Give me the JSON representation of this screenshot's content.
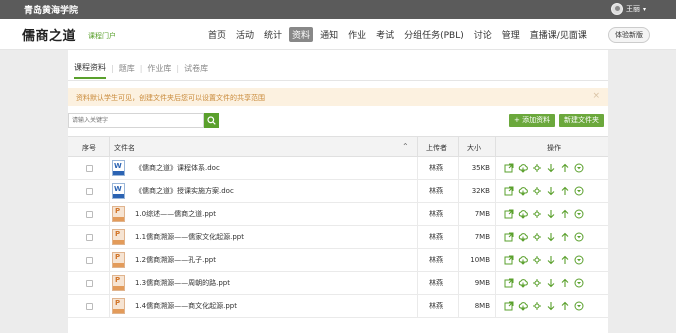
{
  "topbar": {
    "school": "青岛黄海学院",
    "user": "王丽"
  },
  "navbar": {
    "brand": "儒商之道",
    "brand_sub": "课程门户",
    "items": [
      {
        "label": "首页",
        "active": false
      },
      {
        "label": "活动",
        "active": false
      },
      {
        "label": "统计",
        "active": false
      },
      {
        "label": "资料",
        "active": true
      },
      {
        "label": "通知",
        "active": false
      },
      {
        "label": "作业",
        "active": false
      },
      {
        "label": "考试",
        "active": false
      },
      {
        "label": "分组任务(PBL)",
        "active": false
      },
      {
        "label": "讨论",
        "active": false
      },
      {
        "label": "管理",
        "active": false
      },
      {
        "label": "直播课/见面课",
        "active": false
      }
    ],
    "new_version": "体验新版"
  },
  "tabs": [
    "课程资料",
    "题库",
    "作业库",
    "试卷库"
  ],
  "notice": {
    "text": "资料默认学生可见，创建文件夹后您可以设置文件的共享范围",
    "close": "×"
  },
  "search": {
    "placeholder": "请输入关键字"
  },
  "buttons": {
    "add": "+ 添加资料",
    "new_folder": "新建文件夹"
  },
  "table": {
    "headers": {
      "index": "序号",
      "name": "文件名",
      "uploader": "上传者",
      "size": "大小",
      "ops": "操作"
    },
    "rows": [
      {
        "type": "doc",
        "name": "《儒商之道》课程体系.doc",
        "uploader": "林燕",
        "size": "35KB"
      },
      {
        "type": "doc",
        "name": "《儒商之道》授课实施方案.doc",
        "uploader": "林燕",
        "size": "32KB"
      },
      {
        "type": "ppt",
        "name": "1.0综述——儒商之道.ppt",
        "uploader": "林燕",
        "size": "7MB"
      },
      {
        "type": "ppt",
        "name": "1.1儒商溯源——儒家文化起源.ppt",
        "uploader": "林燕",
        "size": "7MB"
      },
      {
        "type": "ppt",
        "name": "1.2儒商溯源——孔子.ppt",
        "uploader": "林燕",
        "size": "10MB"
      },
      {
        "type": "ppt",
        "name": "1.3儒商溯源——周朝的路.ppt",
        "uploader": "林燕",
        "size": "9MB"
      },
      {
        "type": "ppt",
        "name": "1.4儒商溯源——商文化起源.ppt",
        "uploader": "林燕",
        "size": "8MB"
      }
    ]
  },
  "colors": {
    "accent": "#5aa02c",
    "topbar": "#5b5b5b",
    "notice_bg": "#fcf1e0",
    "notice_text": "#c98a3a"
  }
}
